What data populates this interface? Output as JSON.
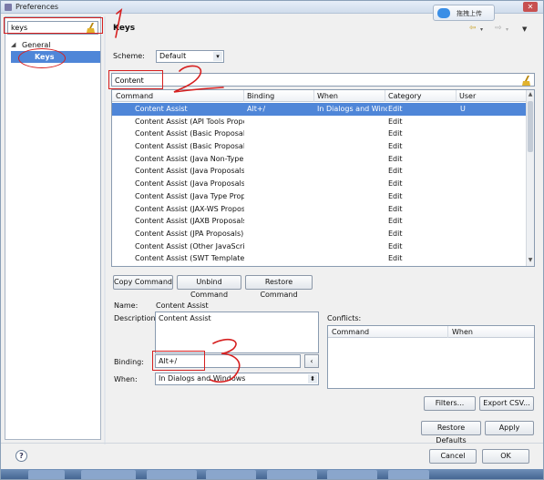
{
  "window": {
    "title": "Preferences"
  },
  "left": {
    "filter_value": "keys",
    "tree": [
      {
        "label": "General",
        "expanded": true
      },
      {
        "label": "Keys",
        "selected": true
      }
    ]
  },
  "header": {
    "title": "Keys",
    "upload_label": "拖拽上传"
  },
  "scheme": {
    "label": "Scheme:",
    "value": "Default"
  },
  "filter": {
    "value": "Content"
  },
  "table": {
    "columns": [
      "Command",
      "Binding",
      "When",
      "Category",
      "User"
    ],
    "rows": [
      {
        "command": "Content Assist",
        "binding": "Alt+/",
        "when": "In Dialogs and Windc",
        "category": "Edit",
        "user": "U",
        "selected": true
      },
      {
        "command": "Content Assist (API Tools Proposa",
        "binding": "",
        "when": "",
        "category": "Edit",
        "user": ""
      },
      {
        "command": "Content Assist (Basic Proposals)",
        "binding": "",
        "when": "",
        "category": "Edit",
        "user": ""
      },
      {
        "command": "Content Assist (Basic Proposals)",
        "binding": "",
        "when": "",
        "category": "Edit",
        "user": ""
      },
      {
        "command": "Content Assist (Java Non-Type Pr",
        "binding": "",
        "when": "",
        "category": "Edit",
        "user": ""
      },
      {
        "command": "Content Assist (Java Proposals (T",
        "binding": "",
        "when": "",
        "category": "Edit",
        "user": ""
      },
      {
        "command": "Content Assist (Java Proposals)",
        "binding": "",
        "when": "",
        "category": "Edit",
        "user": ""
      },
      {
        "command": "Content Assist (Java Type Propos",
        "binding": "",
        "when": "",
        "category": "Edit",
        "user": ""
      },
      {
        "command": "Content Assist (JAX-WS Proposa",
        "binding": "",
        "when": "",
        "category": "Edit",
        "user": ""
      },
      {
        "command": "Content Assist (JAXB Proposals)",
        "binding": "",
        "when": "",
        "category": "Edit",
        "user": ""
      },
      {
        "command": "Content Assist (JPA Proposals)",
        "binding": "",
        "when": "",
        "category": "Edit",
        "user": ""
      },
      {
        "command": "Content Assist (Other JavaScript I",
        "binding": "",
        "when": "",
        "category": "Edit",
        "user": ""
      },
      {
        "command": "Content Assist (SWT Template Pr",
        "binding": "",
        "when": "",
        "category": "Edit",
        "user": ""
      }
    ]
  },
  "buttons": {
    "copy": "Copy Command",
    "unbind": "Unbind Command",
    "restore_cmd": "Restore Command",
    "filters": "Filters...",
    "export": "Export CSV...",
    "restore_defaults": "Restore Defaults",
    "apply": "Apply",
    "cancel": "Cancel",
    "ok": "OK"
  },
  "details": {
    "name_label": "Name:",
    "name_value": "Content Assist",
    "desc_label": "Description:",
    "desc_value": "Content Assist",
    "binding_label": "Binding:",
    "binding_value": "Alt+/",
    "when_label": "When:",
    "when_value": "In Dialogs and Windows",
    "conflicts_label": "Conflicts:",
    "conflicts_columns": [
      "Command",
      "When"
    ]
  },
  "annotations": [
    "1",
    "2",
    "3"
  ],
  "colors": {
    "selection": "#4f86d8",
    "annotation": "#d61f1f"
  }
}
